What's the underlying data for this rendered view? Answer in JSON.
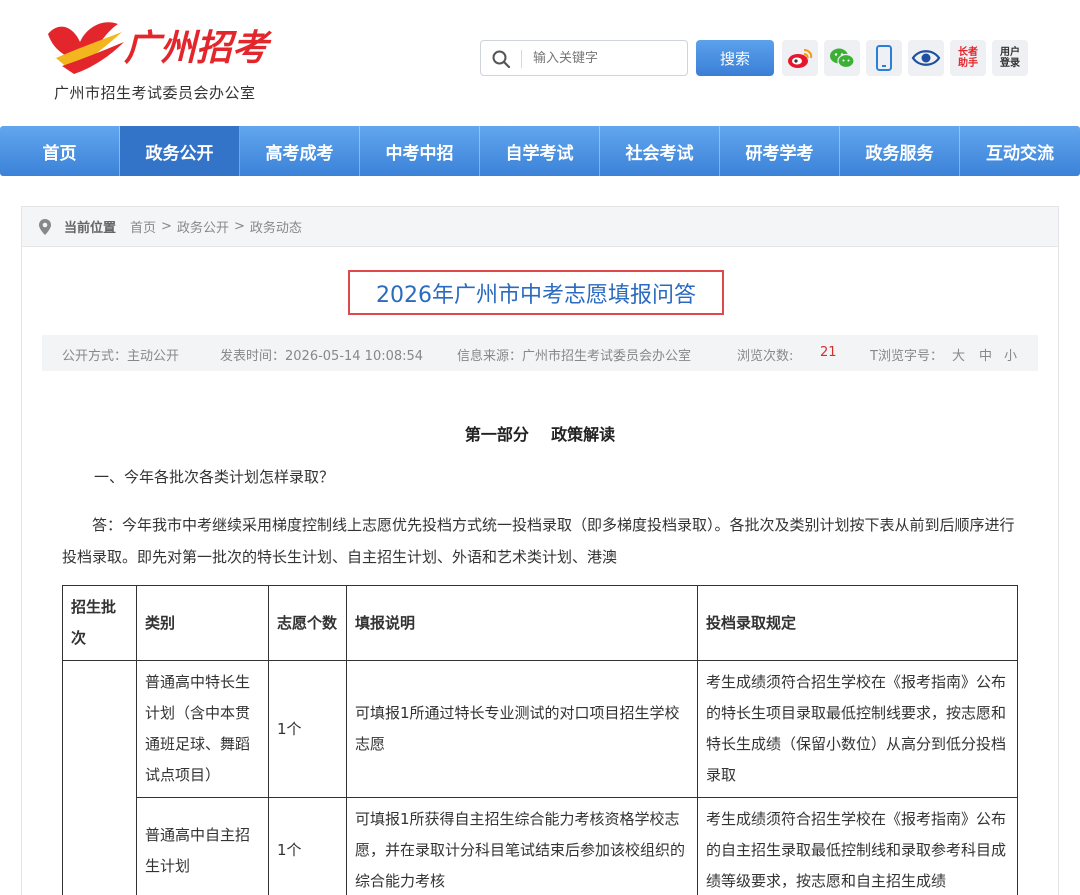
{
  "header": {
    "logo_text": "广州招考",
    "subtitle": "广州市招生考试委员会办公室",
    "search_placeholder": "输入关键字",
    "search_button": "搜索",
    "icon_elder": "长者助手",
    "icon_user": "用户登录",
    "icons": [
      "weibo-icon",
      "wechat-icon",
      "mobile-icon",
      "eye-icon"
    ]
  },
  "nav": {
    "items": [
      "首页",
      "政务公开",
      "高考成考",
      "中考中招",
      "自学考试",
      "社会考试",
      "研考学考",
      "政务服务",
      "互动交流"
    ],
    "active": "政务公开"
  },
  "breadcrumb": {
    "label": "当前位置",
    "path": [
      "首页",
      ">",
      "政务公开",
      ">",
      "政务动态"
    ]
  },
  "article": {
    "title": "2026年广州市中考志愿填报问答",
    "meta": {
      "open_mode": "公开方式：主动公开",
      "publish_time": "发表时间：2026-05-14 10:08:54",
      "source": "信息来源：广州市招生考试委员会办公室",
      "views_label": "浏览次数:",
      "views_count": "21",
      "font_size_label": "T浏览字号：",
      "font_large": "大",
      "font_medium": "中",
      "font_small": "小"
    },
    "section_heading": "第一部分    政策解读",
    "question1": "一、今年各批次各类计划怎样录取？",
    "answer1": "答：今年我市中考继续采用梯度控制线上志愿优先投档方式统一投档录取（即多梯度投档录取）。各批次及类别计划按下表从前到后顺序进行投档录取。即先对第一批次的特长生计划、自主招生计划、外语和艺术类计划、港澳"
  },
  "table": {
    "headers": [
      "招生批次",
      "类别",
      "志愿个数",
      "填报说明",
      "投档录取规定"
    ],
    "rows": [
      {
        "batch": "",
        "category": "普通高中特长生计划（含中本贯通班足球、舞蹈试点项目）",
        "count": "1个",
        "desc": "可填报1所通过特长专业测试的对口项目招生学校志愿",
        "rule": "考生成绩须符合招生学校在《报考指南》公布的特长生项目录取最低控制线要求，按志愿和特长生成绩（保留小数位）从高分到低分投档录取"
      },
      {
        "batch": "",
        "category": "普通高中自主招生计划",
        "count": "1个",
        "desc": "可填报1所获得自主招生综合能力考核资格学校志愿，并在录取计分科目笔试结束后参加该校组织的综合能力考核",
        "rule": "考生成绩须符合招生学校在《报考指南》公布的自主招生录取最低控制线和录取参考科目成绩等级要求，按志愿和自主招生成绩"
      }
    ]
  }
}
